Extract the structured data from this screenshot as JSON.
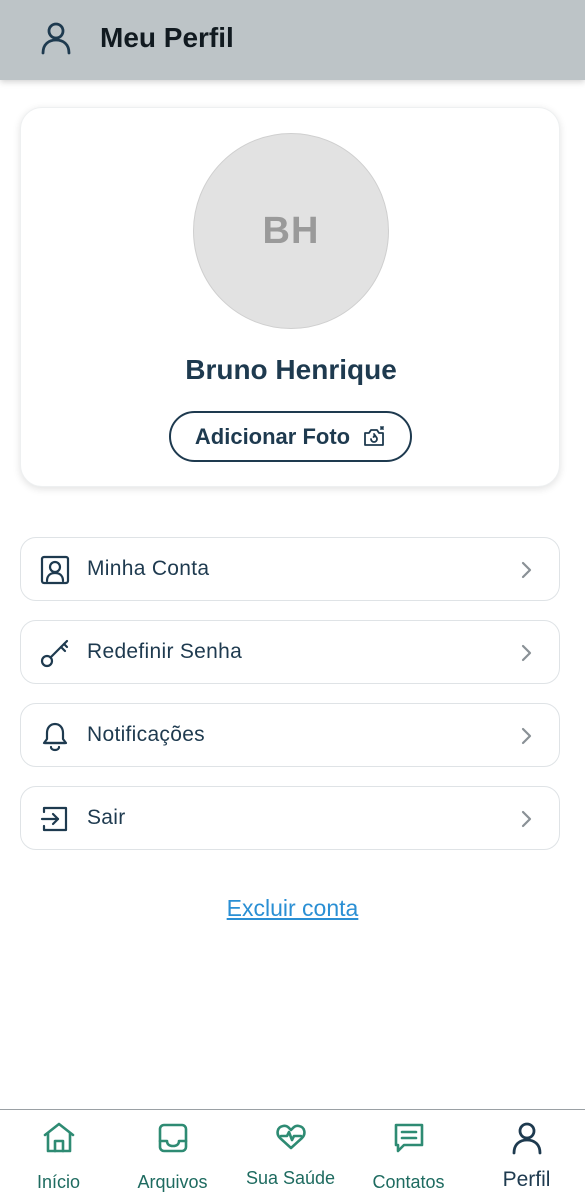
{
  "header": {
    "title": "Meu Perfil",
    "icon": "user-icon",
    "bg_color": "#bdc4c7"
  },
  "profile": {
    "initials": "BH",
    "name": "Bruno Henrique",
    "add_photo_label": "Adicionar Foto",
    "add_photo_icon": "camera-rotate-icon"
  },
  "menu": {
    "items": [
      {
        "label": "Minha Conta",
        "icon": "account-icon"
      },
      {
        "label": "Redefinir Senha",
        "icon": "key-icon"
      },
      {
        "label": "Notificações",
        "icon": "bell-icon"
      },
      {
        "label": "Sair",
        "icon": "logout-icon"
      }
    ]
  },
  "delete_account_label": "Excluir conta",
  "bottom_nav": {
    "items": [
      {
        "label": "Início",
        "icon": "home-icon"
      },
      {
        "label": "Arquivos",
        "icon": "inbox-icon"
      },
      {
        "label": "Sua Saúde",
        "icon": "heart-pulse-icon"
      },
      {
        "label": "Contatos",
        "icon": "message-icon"
      },
      {
        "label": "Perfil",
        "icon": "user-icon",
        "active": true
      }
    ]
  },
  "colors": {
    "primary": "#1e3a4f",
    "accent_green": "#2e8b73",
    "link": "#2a8fd4"
  }
}
